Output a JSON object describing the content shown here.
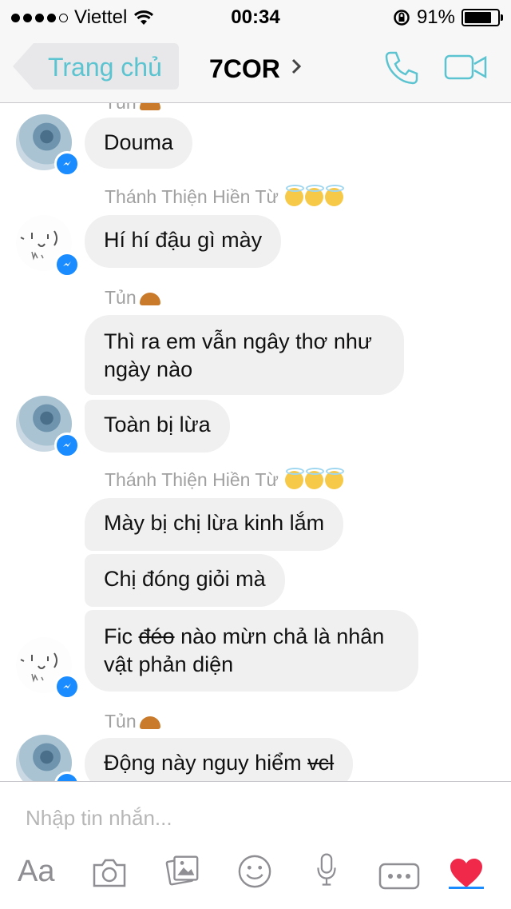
{
  "status_bar": {
    "carrier": "Viettel",
    "time": "00:34",
    "battery": "91%",
    "battery_level": 0.91
  },
  "nav": {
    "back_label": "Trang chủ",
    "title": "7COR"
  },
  "messages": {
    "m1": {
      "sender": "Tủn",
      "text": "Douma"
    },
    "m2": {
      "sender": "Thánh Thiện Hiền Từ",
      "text": "Hí hí đậu gì mày"
    },
    "m3": {
      "sender": "Tủn",
      "line1": "Thì ra em vẫn ngây thơ như",
      "line2": "ngày nào"
    },
    "m4": {
      "text": "Toàn bị lừa"
    },
    "m5": {
      "sender": "Thánh Thiện Hiền Từ",
      "text": "Mày bị chị lừa kinh lắm"
    },
    "m6": {
      "text": "Chị đóng giỏi mà"
    },
    "m7": {
      "part1": "Fic ",
      "strike": "đéo",
      "part2": " nào mừn chả là nhân",
      "line2": "vật phản diện"
    },
    "m8": {
      "sender": "Tủn",
      "text": "Động này nguy hiểm ",
      "strike": "vcl"
    }
  },
  "composer": {
    "placeholder": "Nhập tin nhắn...",
    "aa_label": "Aa"
  },
  "toolbar_icons": [
    "text-style",
    "camera-icon",
    "gallery-icon",
    "emoji-icon",
    "microphone-icon",
    "more-icon",
    "heart-icon"
  ],
  "colors": {
    "accent": "#5bc4d0",
    "messenger_blue": "#1a8cff",
    "bubble": "#f1f0f0",
    "heart": "#f02849"
  }
}
